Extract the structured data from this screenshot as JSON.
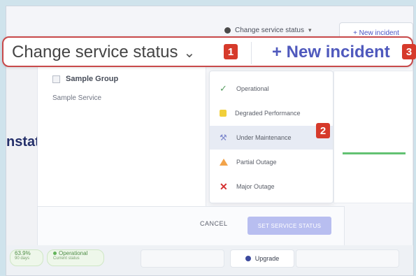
{
  "topbar": {
    "change_status": "Change service status",
    "new_incident": "+ New incident"
  },
  "left_panel": {
    "cut_label": "nstat",
    "group_title": "Sample Group",
    "service_name": "Sample Service"
  },
  "dropdown": {
    "options": [
      {
        "label": "Operational"
      },
      {
        "label": "Degraded Performance"
      },
      {
        "label": "Under Maintenance"
      },
      {
        "label": "Partial Outage"
      },
      {
        "label": "Major Outage"
      }
    ]
  },
  "footer": {
    "cancel": "CANCEL",
    "set_status": "SET SERVICE STATUS"
  },
  "bottom": {
    "uptime_value": "63.9%",
    "uptime_period": "90 days",
    "status_label": "Operational",
    "status_sub": "Current status",
    "upgrade": "Upgrade"
  },
  "zoom": {
    "change_status": "Change service status",
    "new_incident": "+ New incident"
  },
  "callouts": [
    "1",
    "2",
    "3"
  ]
}
